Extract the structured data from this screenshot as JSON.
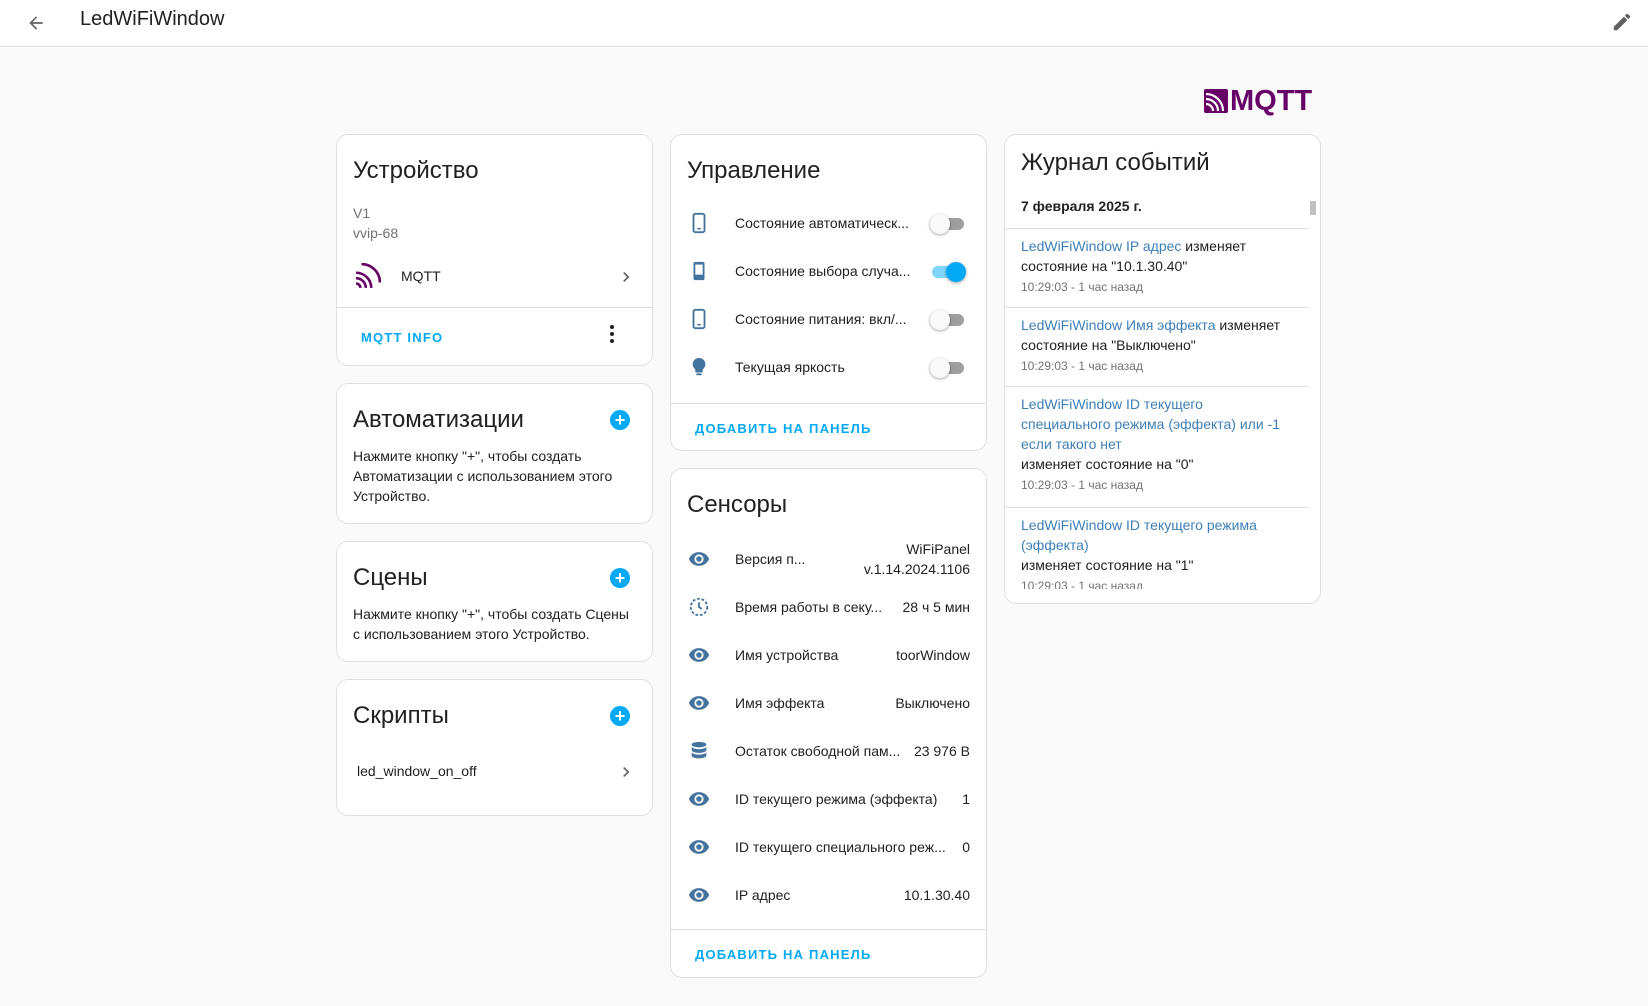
{
  "header": {
    "title": "LedWiFiWindow"
  },
  "brand": {
    "logo_text": "MQTT",
    "color": "#660066"
  },
  "accent_color": "#03a9f4",
  "device": {
    "title": "Устройство",
    "model": "V1",
    "manufacturer": "vvip-68",
    "integration_label": "MQTT",
    "action_label": "MQTT INFO"
  },
  "automations": {
    "title": "Автоматизации",
    "description": "Нажмите кнопку \"+\", чтобы создать Автоматизации с использованием этого Устройство."
  },
  "scenes": {
    "title": "Сцены",
    "description": "Нажмите кнопку \"+\", чтобы создать Сцены с использованием этого Устройство."
  },
  "scripts": {
    "title": "Скрипты",
    "items": [
      {
        "label": "led_window_on_off"
      }
    ]
  },
  "controls": {
    "title": "Управление",
    "add_label": "ДОБАВИТЬ НА ПАНЕЛЬ",
    "items": [
      {
        "icon": "phone-outline-icon",
        "label": "Состояние автоматическ...",
        "on": false
      },
      {
        "icon": "phone-filled-icon",
        "label": "Состояние выбора случа...",
        "on": true
      },
      {
        "icon": "phone-outline-icon",
        "label": "Состояние питания: вкл/...",
        "on": false
      },
      {
        "icon": "lightbulb-icon",
        "label": "Текущая яркость",
        "on": false
      }
    ]
  },
  "sensors": {
    "title": "Сенсоры",
    "add_label": "ДОБАВИТЬ НА ПАНЕЛЬ",
    "items": [
      {
        "icon": "eye-icon",
        "label": "Версия п...",
        "value_line1": "WiFiPanel",
        "value_line2": "v.1.14.2024.1106"
      },
      {
        "icon": "timer-icon",
        "label": "Время работы в секу...",
        "value": "28 ч 5 мин"
      },
      {
        "icon": "eye-icon",
        "label": "Имя устройства",
        "value": "toorWindow"
      },
      {
        "icon": "eye-icon",
        "label": "Имя эффекта",
        "value": "Выключено"
      },
      {
        "icon": "database-icon",
        "label": "Остаток свободной пам...",
        "value": "23 976 B"
      },
      {
        "icon": "eye-icon",
        "label": "ID текущего режима (эффекта)",
        "value": "1"
      },
      {
        "icon": "eye-icon",
        "label": "ID текущего специального реж...",
        "value": "0"
      },
      {
        "icon": "eye-icon",
        "label": "IP адрес",
        "value": "10.1.30.40"
      }
    ]
  },
  "logbook": {
    "title": "Журнал событий",
    "date": "7 февраля 2025 г.",
    "entries": [
      {
        "entity_lines": [
          "LedWiFiWindow IP адрес"
        ],
        "message_inline": " изменяет",
        "message_lines": [
          "состояние на \"10.1.30.40\""
        ],
        "time": "10:29:03 - 1 час назад"
      },
      {
        "entity_lines": [
          "LedWiFiWindow Имя эффекта"
        ],
        "message_inline": " изменяет",
        "message_lines": [
          "состояние на \"Выключено\""
        ],
        "time": "10:29:03 - 1 час назад"
      },
      {
        "entity_lines": [
          "LedWiFiWindow ID текущего",
          "специального режима (эффекта) или -1",
          "если такого нет"
        ],
        "message_inline": "",
        "message_lines": [
          "изменяет состояние на \"0\""
        ],
        "time": "10:29:03 - 1 час назад"
      },
      {
        "entity_lines": [
          "LedWiFiWindow ID текущего режима",
          "(эффекта)"
        ],
        "message_inline": "",
        "message_lines": [
          "изменяет состояние на \"1\""
        ],
        "time": "10:29:03 - 1 час назад"
      }
    ]
  }
}
